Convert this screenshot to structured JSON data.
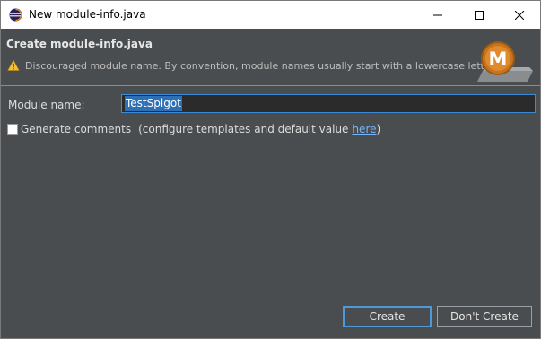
{
  "window": {
    "title": "New module-info.java"
  },
  "banner": {
    "title": "Create module-info.java",
    "warning": "Discouraged module name. By convention, module names usually start with a lowercase letter",
    "logo_letter": "M"
  },
  "form": {
    "module_name_label": "Module name:",
    "module_name_value": "TestSpigot",
    "generate_comments_label": "Generate comments",
    "generate_comments_checked": false,
    "configure_text": "(configure templates and default value",
    "configure_link": "here",
    "configure_close": ")"
  },
  "buttons": {
    "create": "Create",
    "dont_create": "Don't Create"
  },
  "colors": {
    "background": "#4a4d4f",
    "accent": "#3b8bd6",
    "link": "#6fb6ff",
    "logo": "#c8741e"
  }
}
